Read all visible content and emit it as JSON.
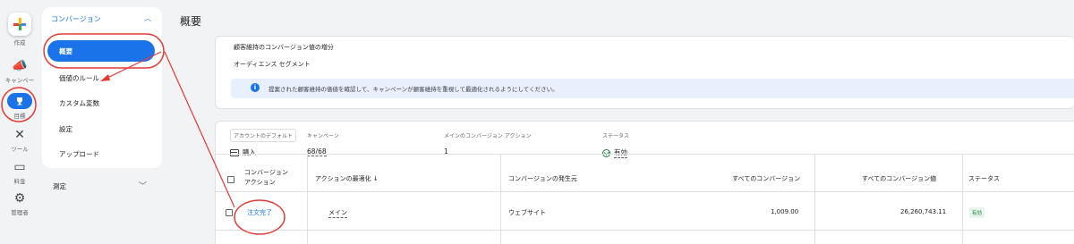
{
  "rail": {
    "create_label": "作成",
    "campaign_label": "キャンペー",
    "goals_label": "目標",
    "tools_label": "ツール",
    "billing_label": "料金",
    "admin_label": "管理者"
  },
  "subnav": {
    "section_label": "コンバージョン",
    "items": [
      "概要",
      "価値のルール",
      "カスタム変数",
      "設定",
      "アップロード"
    ],
    "measure_label": "測定"
  },
  "page": {
    "title": "概要"
  },
  "card1": {
    "line1": "顧客維持のコンバージョン値の増分",
    "line2": "オーディエンス セグメント",
    "info": "提案された顧客維持の価値を確認して、キャンペーンが顧客維持を重視して最適化されるようにしてください。"
  },
  "meta": {
    "account_default_label": "アカウントのデフォルト",
    "campaign_label": "キャンペーン",
    "main_action_label": "メインのコンバージョン アクション",
    "status_label": "ステータス",
    "account_default_value": "購入",
    "campaign_value": "68/68",
    "main_action_value": "1",
    "status_value": "有効"
  },
  "table": {
    "headers": [
      "コンバージョン アクション",
      "アクションの最適化 ↓",
      "コンバージョンの発生元",
      "すべてのコンバージョン",
      "すべてのコンバージョン値",
      "ステータス"
    ],
    "header_action_line1": "コンバージョン",
    "header_action_line2": "アクション",
    "row": {
      "action": "注文完了",
      "optimization": "メイン",
      "source": "ウェブサイト",
      "all_conversions": "1,009.00",
      "all_conversion_value": "26,260,743.11",
      "status": "有効"
    }
  },
  "colors": {
    "accent": "#1a73e8",
    "annotation": "#e53935",
    "success": "#188038"
  }
}
